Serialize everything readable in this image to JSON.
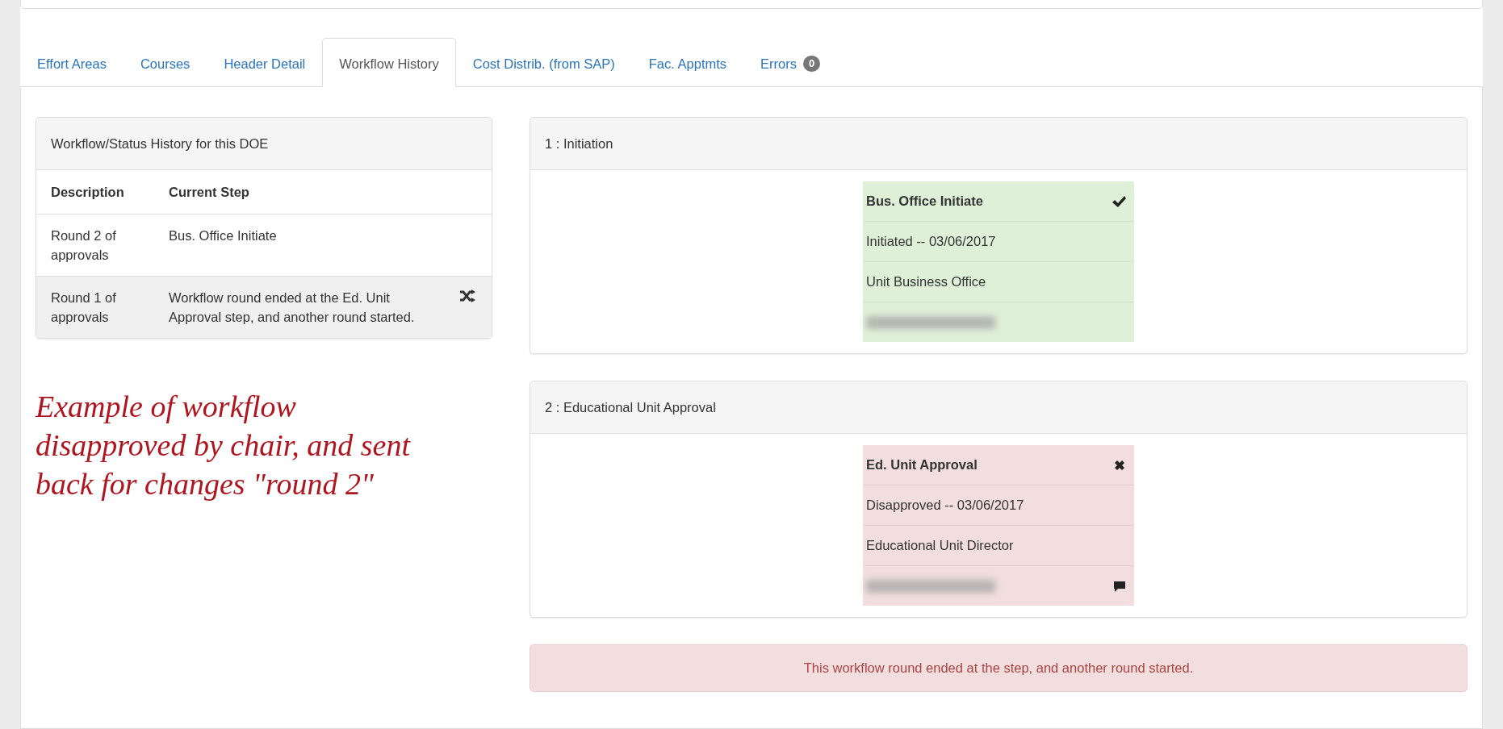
{
  "tabs": [
    {
      "label": "Effort Areas",
      "selected": false
    },
    {
      "label": "Courses",
      "selected": false
    },
    {
      "label": "Header Detail",
      "selected": false
    },
    {
      "label": "Workflow History",
      "selected": true
    },
    {
      "label": "Cost Distrib. (from SAP)",
      "selected": false
    },
    {
      "label": "Fac. Apptmts",
      "selected": false
    },
    {
      "label": "Errors",
      "selected": false,
      "badge": "0"
    }
  ],
  "history": {
    "title": "Workflow/Status History for this DOE",
    "columns": [
      "Description",
      "Current Step"
    ],
    "rows": [
      {
        "description": "Round 2 of approvals",
        "step": "Bus. Office Initiate",
        "highlighted": false,
        "restarted": false
      },
      {
        "description": "Round 1 of approvals",
        "step": "Workflow round ended at the Ed. Unit Approval step, and another round started.",
        "highlighted": true,
        "restarted": true
      }
    ]
  },
  "annotation": [
    "Example of workflow",
    "disapproved by chair, and sent",
    "back for changes \"round 2\""
  ],
  "stages": [
    {
      "title": "1 : Initiation",
      "step": {
        "name": "Bus. Office Initiate",
        "approved": true,
        "action": "Initiated -- 03/06/2017",
        "role": "Unit Business Office",
        "redacted": true,
        "has_comment": false
      }
    },
    {
      "title": "2 : Educational Unit Approval",
      "step": {
        "name": "Ed. Unit Approval",
        "approved": false,
        "action": "Disapproved -- 03/06/2017",
        "role": "Educational Unit Director",
        "redacted": true,
        "has_comment": true
      }
    }
  ],
  "alert": {
    "text": "This workflow round ended at the step, and another round started."
  }
}
